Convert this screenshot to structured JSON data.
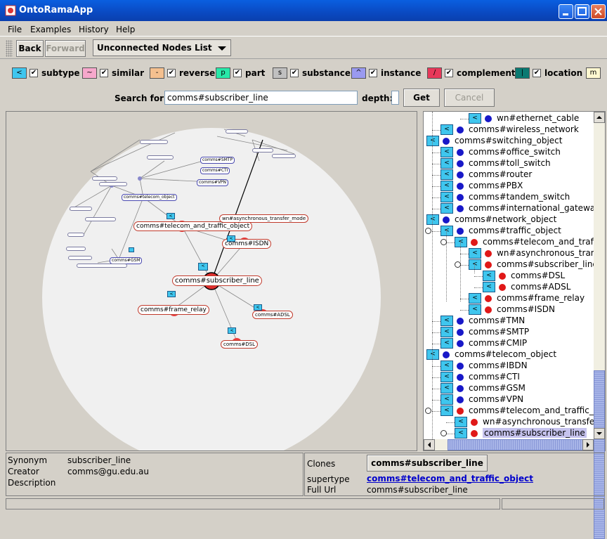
{
  "window": {
    "title": "OntoRamaApp"
  },
  "menu": [
    "File",
    "Examples",
    "History",
    "Help"
  ],
  "toolbar": {
    "back": "Back",
    "forward": "Forward",
    "view_select": "Unconnected Nodes List"
  },
  "legend": [
    {
      "symbol": "<",
      "label": "subtype",
      "color": "#3fc6ee"
    },
    {
      "symbol": "~",
      "label": "similar",
      "color": "#f7a8cc"
    },
    {
      "symbol": "-",
      "label": "reverse",
      "color": "#f5c08f"
    },
    {
      "symbol": "p",
      "label": "part",
      "color": "#27e8a8"
    },
    {
      "symbol": "s",
      "label": "substance",
      "color": "#c0c0c0"
    },
    {
      "symbol": "^",
      "label": "instance",
      "color": "#9a9af0"
    },
    {
      "symbol": "/",
      "label": "complement",
      "color": "#e8385a"
    },
    {
      "symbol": "|",
      "label": "location",
      "color": "#0a7a72"
    },
    {
      "symbol": "m",
      "label": "",
      "color": "#fff8d0"
    }
  ],
  "search": {
    "label": "Search for:",
    "value": "comms#subscriber_line",
    "depth_label": "depth:",
    "depth_value": "",
    "get": "Get",
    "cancel": "Cancel"
  },
  "graph": {
    "focus": "comms#subscriber_line",
    "nodes": [
      "comms#telecom_and_traffic_object",
      "wn#asynchronous_transfer_mode",
      "comms#ISDN",
      "comms#frame_relay",
      "comms#ADSL",
      "comms#DSL",
      "comms#telecom_object",
      "comms#GSM",
      "comms#CTI",
      "comms#VPN",
      "comms#SMTP"
    ]
  },
  "tree": [
    {
      "label": "wn#ethernet_cable",
      "dot": "blue",
      "indent": 3
    },
    {
      "label": "comms#wireless_network",
      "dot": "blue",
      "indent": 1
    },
    {
      "label": "comms#switching_object",
      "dot": "blue",
      "indent": 0
    },
    {
      "label": "comms#office_switch",
      "dot": "blue",
      "indent": 1
    },
    {
      "label": "comms#toll_switch",
      "dot": "blue",
      "indent": 1
    },
    {
      "label": "comms#router",
      "dot": "blue",
      "indent": 1
    },
    {
      "label": "comms#PBX",
      "dot": "blue",
      "indent": 1
    },
    {
      "label": "comms#tandem_switch",
      "dot": "blue",
      "indent": 1
    },
    {
      "label": "comms#international_gateway",
      "dot": "blue",
      "indent": 1
    },
    {
      "label": "comms#network_object",
      "dot": "blue",
      "indent": 0
    },
    {
      "label": "comms#traffic_object",
      "dot": "blue",
      "indent": 1
    },
    {
      "label": "comms#telecom_and_traffic",
      "dot": "red",
      "indent": 2
    },
    {
      "label": "wn#asynchronous_transf",
      "dot": "red",
      "indent": 3
    },
    {
      "label": "comms#subscriber_line",
      "dot": "red",
      "indent": 3
    },
    {
      "label": "comms#DSL",
      "dot": "red",
      "indent": 4
    },
    {
      "label": "comms#ADSL",
      "dot": "red",
      "indent": 4
    },
    {
      "label": "comms#frame_relay",
      "dot": "red",
      "indent": 3
    },
    {
      "label": "comms#ISDN",
      "dot": "red",
      "indent": 3
    },
    {
      "label": "comms#TMN",
      "dot": "blue",
      "indent": 1
    },
    {
      "label": "comms#SMTP",
      "dot": "blue",
      "indent": 1
    },
    {
      "label": "comms#CMIP",
      "dot": "blue",
      "indent": 1
    },
    {
      "label": "comms#telecom_object",
      "dot": "blue",
      "indent": 0
    },
    {
      "label": "comms#IBDN",
      "dot": "blue",
      "indent": 1
    },
    {
      "label": "comms#CTI",
      "dot": "blue",
      "indent": 1
    },
    {
      "label": "comms#GSM",
      "dot": "blue",
      "indent": 1
    },
    {
      "label": "comms#VPN",
      "dot": "blue",
      "indent": 1
    },
    {
      "label": "comms#telecom_and_traffic_ob",
      "dot": "red",
      "indent": 1
    },
    {
      "label": "wn#asynchronous_transfer_",
      "dot": "red",
      "indent": 2
    },
    {
      "label": "comms#subscriber_line",
      "dot": "red",
      "indent": 2,
      "selected": true
    }
  ],
  "info": {
    "synonym_label": "Synonym",
    "synonym": "subscriber_line",
    "creator_label": "Creator",
    "creator": "comms@gu.edu.au",
    "description_label": "Description",
    "clones_label": "Clones",
    "clones_button": "comms#subscriber_line",
    "supertype_label": "supertype",
    "supertype": "comms#telecom_and_traffic_object",
    "fullurl_label": "Full Url",
    "fullurl": "comms#subscriber_line"
  }
}
